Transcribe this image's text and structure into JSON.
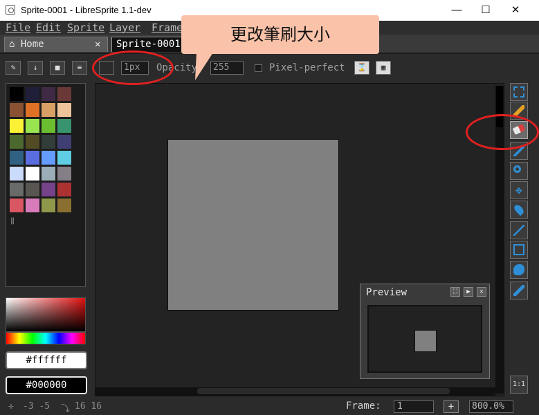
{
  "window": {
    "title": "Sprite-0001 - LibreSprite 1.1-dev",
    "minimize": "—",
    "maximize": "☐",
    "close": "✕"
  },
  "menu": {
    "items": [
      "File",
      "Edit",
      "Sprite",
      "Layer",
      "Frame"
    ]
  },
  "tabs": {
    "home_label": "Home",
    "home_close": "✕",
    "sprite_label": "Sprite-0001"
  },
  "context_bar": {
    "brush_size": "1px",
    "opacity_label": "Opacity:",
    "opacity_value": "255",
    "pixel_perfect_label": "Pixel-perfect"
  },
  "palette": {
    "colors": [
      "#000000",
      "#1f1f3a",
      "#3f2a45",
      "#6b3838",
      "#8a5232",
      "#df7126",
      "#d9a066",
      "#eec39a",
      "#fbf236",
      "#99e550",
      "#6abe30",
      "#37946e",
      "#4b692f",
      "#524b24",
      "#323c39",
      "#3f3f74",
      "#306082",
      "#5b6ee1",
      "#639bff",
      "#5fcde4",
      "#cbdbfc",
      "#ffffff",
      "#9badb7",
      "#847e87",
      "#696a6a",
      "#595652",
      "#76428a",
      "#ac3232",
      "#d95763",
      "#d77bba",
      "#8f974a",
      "#8a6f30"
    ]
  },
  "colors": {
    "foreground": "#ffffff",
    "background": "#000000",
    "annotation_red": "#e12020",
    "callout_bg": "#fac3a9"
  },
  "preview": {
    "title": "Preview"
  },
  "status": {
    "coords": "-3 -5",
    "size": "16 16",
    "frame_label": "Frame:",
    "frame_value": "1",
    "zoom": "800.0%",
    "zoom_button": "1:1"
  },
  "annotation": {
    "callout_text": "更改筆刷大小"
  },
  "tools": [
    "marquee-icon",
    "pencil-icon",
    "eraser-icon",
    "eyedropper-icon",
    "zoom-icon",
    "move-icon",
    "paint-bucket-icon",
    "line-icon",
    "rectangle-icon",
    "lasso-icon",
    "spray-icon"
  ]
}
